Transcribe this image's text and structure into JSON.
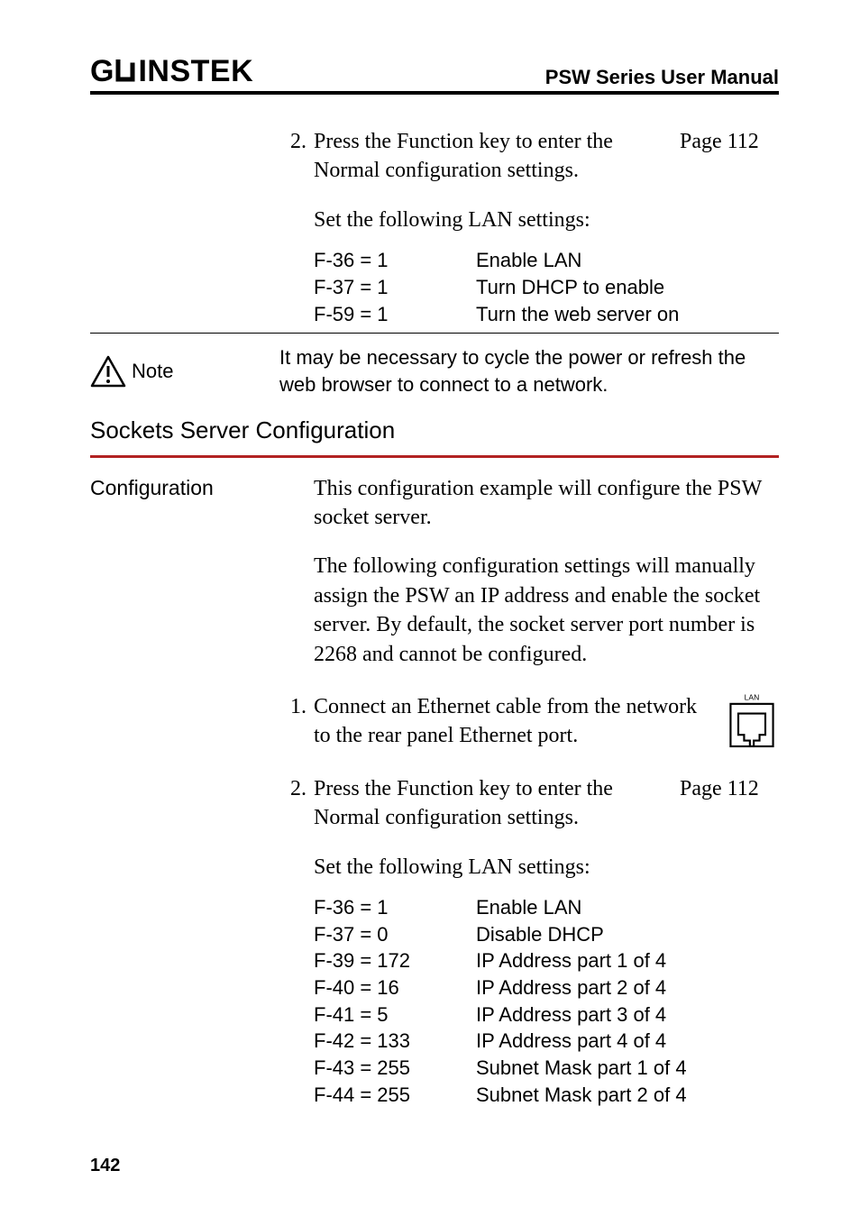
{
  "header": {
    "logo_left": "G",
    "logo_right": "INSTEK",
    "manual_title": "PSW Series User Manual"
  },
  "top_step": {
    "num": "2.",
    "text": "Press the Function key to enter the Normal configuration settings.",
    "page_ref": "Page  112",
    "lan_intro": "Set the following LAN settings:",
    "settings": [
      {
        "k": "F-36 = 1",
        "v": "Enable LAN"
      },
      {
        "k": "F-37 = 1",
        "v": "Turn DHCP to enable"
      },
      {
        "k": "F-59 = 1",
        "v": "Turn the web server on"
      }
    ]
  },
  "note": {
    "label": "Note",
    "text": "It may be necessary to cycle the power or refresh the web browser to connect to a network."
  },
  "section_heading": "Sockets Server Configuration",
  "config": {
    "label": "Configuration",
    "para1": "This configuration example will configure the PSW socket server.",
    "para2": "The following configuration settings will manually assign the PSW an IP address and enable the socket server. By default, the socket server port number is 2268 and cannot be configured."
  },
  "step1": {
    "num": "1.",
    "text": "Connect an Ethernet cable from the network to the rear panel Ethernet port.",
    "lan_label": "LAN"
  },
  "step2": {
    "num": "2.",
    "text": "Press the Function key to enter the Normal configuration settings.",
    "page_ref": "Page  112",
    "lan_intro": "Set the following LAN settings:",
    "settings": [
      {
        "k": "F-36 = 1",
        "v": "Enable LAN"
      },
      {
        "k": "F-37 = 0",
        "v": "Disable DHCP"
      },
      {
        "k": "F-39 = 172",
        "v": "IP Address part 1 of 4"
      },
      {
        "k": "F-40 = 16",
        "v": "IP Address part 2 of 4"
      },
      {
        "k": "F-41 =  5",
        "v": "IP Address part 3 of 4"
      },
      {
        "k": "F-42 =  133",
        "v": "IP Address part 4 of 4"
      },
      {
        "k": "F-43 = 255",
        "v": "Subnet Mask part 1 of 4"
      },
      {
        "k": "F-44 = 255",
        "v": "Subnet Mask part 2 of 4"
      }
    ]
  },
  "page_number": "142"
}
